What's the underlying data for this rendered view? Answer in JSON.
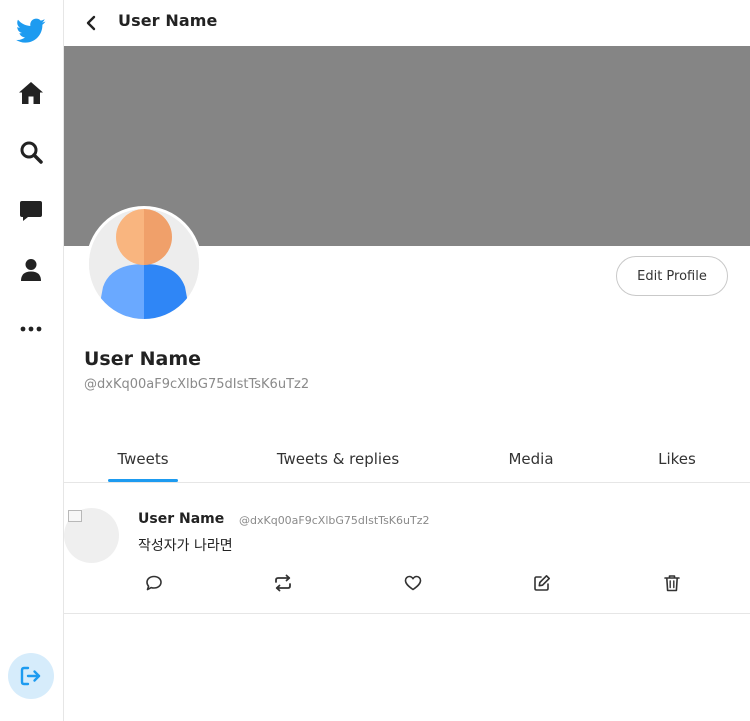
{
  "sidebar": {
    "items": [
      {
        "icon": "twitter-bird-icon",
        "color": "#1d9bf0"
      },
      {
        "icon": "home-icon"
      },
      {
        "icon": "search-icon"
      },
      {
        "icon": "messages-icon"
      },
      {
        "icon": "profile-icon"
      },
      {
        "icon": "more-icon"
      }
    ],
    "logout": {
      "icon": "logout-icon",
      "background": "#d6ecfb",
      "color": "#1d9bf0"
    }
  },
  "header": {
    "title": "User Name"
  },
  "profile": {
    "banner_color": "#858585",
    "name": "User Name",
    "handle": "@dxKq00aF9cXlbG75dIstTsK6uTz2",
    "edit_button": "Edit Profile"
  },
  "tabs": [
    {
      "label": "Tweets",
      "active": true
    },
    {
      "label": "Tweets & replies",
      "active": false
    },
    {
      "label": "Media",
      "active": false
    },
    {
      "label": "Likes",
      "active": false
    }
  ],
  "tweets": [
    {
      "name": "User Name",
      "handle": "@dxKq00aF9cXlbG75dIstTsK6uTz2",
      "text": "작성자가 나라면",
      "actions": [
        "reply-icon",
        "retweet-icon",
        "like-icon",
        "edit-icon",
        "delete-icon"
      ]
    }
  ],
  "colors": {
    "accent": "#1d9bf0",
    "text": "#222222",
    "muted": "#8a8a8a"
  }
}
